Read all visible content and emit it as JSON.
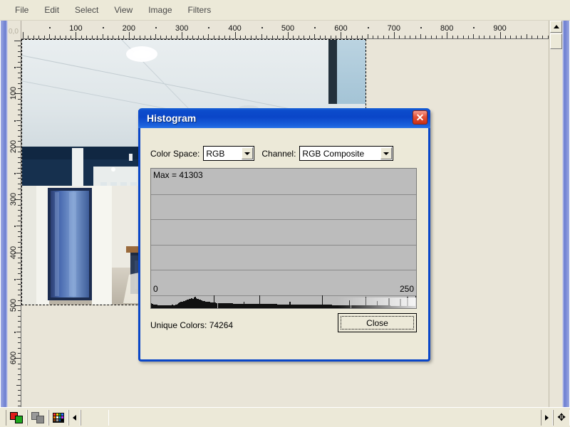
{
  "menu": {
    "items": [
      {
        "label": "File"
      },
      {
        "label": "Edit"
      },
      {
        "label": "Select"
      },
      {
        "label": "View"
      },
      {
        "label": "Image"
      },
      {
        "label": "Filters"
      }
    ]
  },
  "rulers": {
    "origin_label": "0,0",
    "horizontal_ticks": [
      100,
      200,
      300,
      400,
      500,
      600,
      700,
      800,
      900
    ],
    "vertical_ticks": [
      100,
      200,
      300,
      400,
      500,
      600
    ],
    "unit_step": 100
  },
  "dialog": {
    "title": "Histogram",
    "close_icon": "✕",
    "color_space_label": "Color Space:",
    "color_space_value": "RGB",
    "channel_label": "Channel:",
    "channel_value": "RGB Composite",
    "max_label": "Max = 41303",
    "axis_min": "0",
    "axis_max": "250",
    "unique_colors": "Unique Colors: 74264",
    "close_button": "Close",
    "title_bar_color": "#0a46c8",
    "close_btn_color": "#c92f14",
    "plot_bg_color": "#bcbcbc"
  },
  "chart_data": {
    "type": "bar",
    "title": "Histogram",
    "subtitle": "Max = 41303",
    "xlabel": "",
    "ylabel": "",
    "xlim": [
      0,
      250
    ],
    "ylim": [
      0,
      41303
    ],
    "grid": true,
    "gridlines": 4,
    "legend": "none",
    "annotations": [
      "Max = 41303",
      "Unique Colors: 74264"
    ],
    "x": [
      0,
      1,
      2,
      3,
      4,
      5,
      6,
      7,
      8,
      9,
      10,
      11,
      12,
      13,
      14,
      15,
      16,
      17,
      18,
      19,
      20,
      21,
      22,
      23,
      24,
      25,
      26,
      27,
      28,
      29,
      30,
      31,
      32,
      33,
      34,
      35,
      36,
      37,
      38,
      39,
      40,
      41,
      42,
      43,
      44,
      45,
      46,
      47,
      48,
      49,
      50,
      51,
      52,
      53,
      54,
      55,
      56,
      57,
      58,
      59,
      60,
      61,
      62,
      63,
      64,
      65,
      66,
      67,
      68,
      69,
      70,
      71,
      72,
      73,
      74,
      75,
      76,
      77,
      78,
      79,
      80,
      81,
      82,
      83,
      84,
      85,
      86,
      87,
      88,
      89,
      90,
      91,
      92,
      93,
      94,
      95,
      96,
      97,
      98,
      99,
      100,
      101,
      102,
      103,
      104,
      105,
      106,
      107,
      108,
      109,
      110,
      111,
      112,
      113,
      114,
      115,
      116,
      117,
      118,
      119,
      120,
      121,
      122,
      123,
      124,
      125,
      126,
      127,
      128,
      129,
      130,
      131,
      132,
      133,
      134,
      135,
      136,
      137,
      138,
      139,
      140,
      141,
      142,
      143,
      144,
      145,
      146,
      147,
      148,
      149,
      150,
      151,
      152,
      153,
      154,
      155,
      156,
      157,
      158,
      159,
      160,
      161,
      162,
      163,
      164,
      165,
      166,
      167,
      168,
      169,
      170,
      171,
      172,
      173,
      174,
      175,
      176,
      177,
      178,
      179,
      180,
      181,
      182,
      183,
      184,
      185,
      186,
      187,
      188,
      189,
      190,
      191,
      192,
      193,
      194,
      195,
      196,
      197,
      198,
      199,
      200,
      201,
      202,
      203,
      204,
      205,
      206,
      207,
      208,
      209,
      210,
      211,
      212,
      213,
      214,
      215,
      216,
      217,
      218,
      219,
      220,
      221,
      222,
      223,
      224,
      225,
      226,
      227,
      228,
      229,
      230,
      231,
      232,
      233,
      234,
      235,
      236,
      237,
      238,
      239,
      240,
      241,
      242,
      243,
      244,
      245,
      246,
      247,
      248,
      249,
      250
    ],
    "values": [
      900,
      700,
      500,
      450,
      420,
      400,
      380,
      360,
      340,
      330,
      320,
      310,
      300,
      300,
      290,
      290,
      280,
      280,
      280,
      270,
      400,
      350,
      300,
      420,
      500,
      650,
      900,
      1100,
      1300,
      1500,
      1400,
      1600,
      1800,
      2000,
      2200,
      2400,
      2600,
      2900,
      3200,
      3000,
      2800,
      3400,
      3800,
      3200,
      2800,
      2600,
      2400,
      2200,
      2000,
      1800,
      1700,
      1600,
      1500,
      1400,
      1400,
      1300,
      1300,
      1200,
      1200,
      1100,
      5200,
      1100,
      1000,
      1000,
      950,
      950,
      900,
      900,
      880,
      860,
      850,
      840,
      830,
      820,
      810,
      800,
      800,
      790,
      780,
      770,
      760,
      760,
      750,
      750,
      740,
      740,
      730,
      730,
      720,
      1400,
      720,
      710,
      710,
      700,
      700,
      690,
      690,
      680,
      680,
      670,
      670,
      660,
      660,
      650,
      4900,
      650,
      640,
      640,
      630,
      630,
      620,
      620,
      610,
      610,
      600,
      600,
      600,
      590,
      590,
      580,
      580,
      570,
      570,
      560,
      560,
      560,
      550,
      550,
      540,
      540,
      530,
      530,
      530,
      1300,
      520,
      520,
      510,
      510,
      510,
      500,
      500,
      500,
      490,
      490,
      490,
      480,
      480,
      480,
      470,
      470,
      470,
      460,
      460,
      460,
      450,
      450,
      450,
      440,
      440,
      440,
      430,
      430,
      430,
      420,
      4800,
      420,
      420,
      410,
      410,
      410,
      400,
      400,
      400,
      400,
      390,
      390,
      390,
      380,
      380,
      380,
      380,
      370,
      370,
      370,
      360,
      360,
      360,
      360,
      350,
      350,
      1900,
      350,
      340,
      340,
      340,
      340,
      330,
      330,
      330,
      330,
      320,
      320,
      320,
      320,
      310,
      310,
      3900,
      310,
      300,
      300,
      300,
      300,
      290,
      290,
      290,
      290,
      280,
      1800,
      280,
      280,
      280,
      270,
      270,
      270,
      270,
      260,
      260,
      260,
      3100,
      260,
      250,
      250,
      250,
      250,
      240,
      240,
      240,
      240,
      230,
      2700,
      230,
      230,
      230,
      220,
      220,
      220,
      4200,
      220,
      210,
      210,
      210,
      210,
      200,
      200,
      4600,
      6000
    ]
  },
  "scrollbars": {
    "v_up_icon": "scroll-up-arrow",
    "v_down_icon": "scroll-down-arrow",
    "h_left_icon": "scroll-left-arrow",
    "h_right_icon": "scroll-right-arrow"
  },
  "statusbar": {
    "items": [
      {
        "icon": "color-swatch-icon"
      },
      {
        "icon": "layers-icon"
      },
      {
        "icon": "palette-icon"
      },
      {
        "icon": "left-arrow-icon"
      }
    ],
    "right_items": [
      {
        "icon": "right-arrow-icon"
      },
      {
        "icon": "move-tool-icon"
      }
    ],
    "move_glyph": "✥"
  }
}
